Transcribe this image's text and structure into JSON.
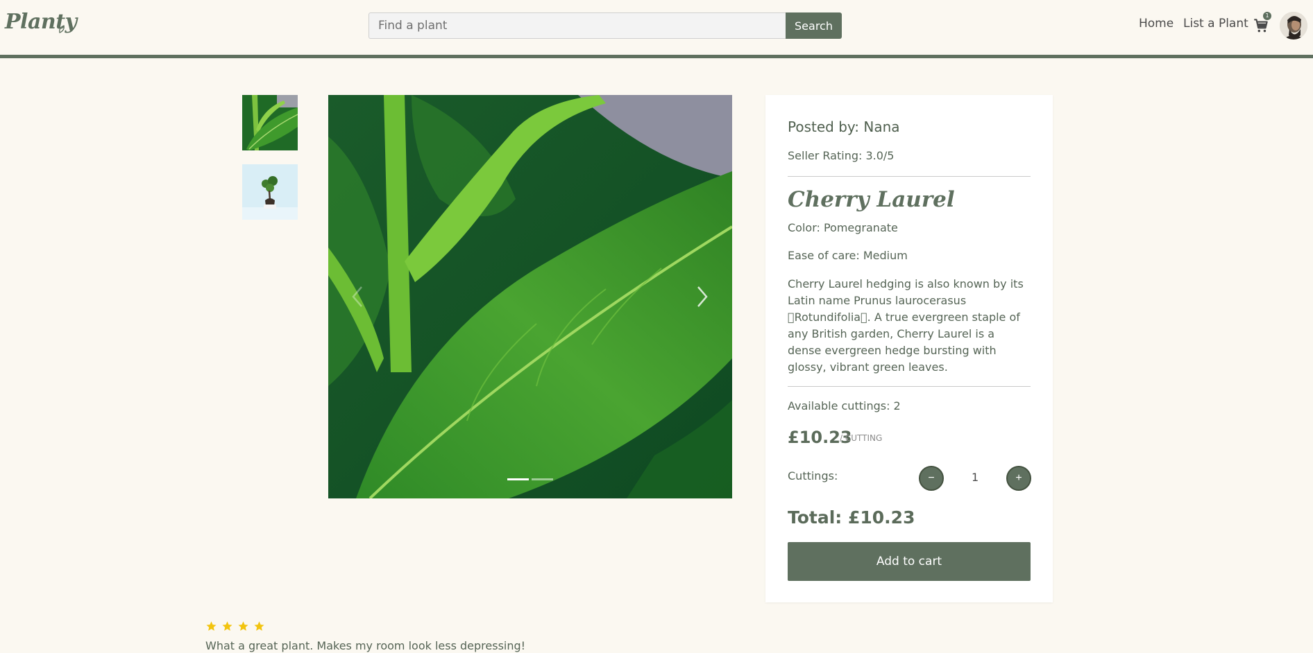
{
  "navbar": {
    "logo": "Planty",
    "search_placeholder": "Find a plant",
    "search_button": "Search",
    "links": [
      "Home",
      "List a Plant"
    ],
    "cart_count": "1",
    "cart_icon": "cart-icon",
    "avatar": "user-avatar"
  },
  "gallery": {
    "thumbnails": [
      "cherry-laurel-leaf-thumbnail",
      "bonsai-tree-thumbnail"
    ],
    "slide_count": 2,
    "active_slide": 1
  },
  "details": {
    "posted_by": "Posted by: Nana",
    "seller_rating": "Seller Rating: 3.0/5",
    "name": "Cherry Laurel",
    "color": "Color: Pomegranate",
    "ease_of_care": "Ease of care: Medium",
    "description": "Cherry Laurel hedging is also known by its Latin name Prunus laurocerasus \u0000Rotundifolia\u0000. A true evergreen staple of any British garden, Cherry Laurel is a dense evergreen hedge bursting with glossy, vibrant green leaves.",
    "available": "Available cuttings: 2",
    "price": "£10.23",
    "price_unit": "/ CUTTING",
    "cuttings_label": "Cuttings:",
    "minus": "−",
    "plus": "+",
    "quantity": "1",
    "total": "Total: £10.23",
    "add_to_cart": "Add to cart"
  },
  "review": {
    "stars": 4,
    "text": "What a great plant. Makes my room look less depressing!"
  },
  "colors": {
    "primary": "#5f705f",
    "background": "#fbf8f1",
    "star": "#f2c40f"
  }
}
